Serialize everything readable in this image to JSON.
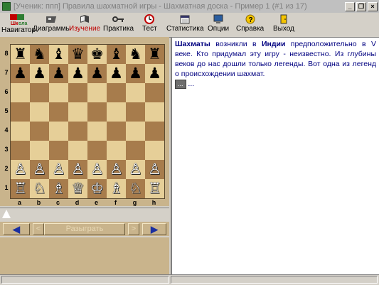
{
  "window": {
    "title": "[Ученик: ппп] Правила шахматной игры - Шахматная доска - Пример 1 (#1 из 17)",
    "controls": [
      "_",
      "❐",
      "×"
    ]
  },
  "toolbar": {
    "navigator": "Навигатор",
    "items": [
      {
        "label": "Диаграммы",
        "icon": "diagrams-icon"
      },
      {
        "label": "Изучение",
        "icon": "book-icon"
      },
      {
        "label": "Практика",
        "icon": "key-icon"
      },
      {
        "label": "Тест",
        "icon": "clock-icon"
      },
      {
        "label": "Статистика",
        "icon": "calendar-icon"
      },
      {
        "label": "Опции",
        "icon": "monitor-icon"
      },
      {
        "label": "Справка",
        "icon": "help-icon"
      },
      {
        "label": "Выход",
        "icon": "door-icon"
      }
    ],
    "active": "Изучение",
    "active_color": "#c00000"
  },
  "board": {
    "ranks": [
      "8",
      "7",
      "6",
      "5",
      "4",
      "3",
      "2",
      "1"
    ],
    "files": [
      "a",
      "b",
      "c",
      "d",
      "e",
      "f",
      "g",
      "h"
    ],
    "position": [
      [
        "♜",
        "♞",
        "♝",
        "♛",
        "♚",
        "♝",
        "♞",
        "♜"
      ],
      [
        "♟",
        "♟",
        "♟",
        "♟",
        "♟",
        "♟",
        "♟",
        "♟"
      ],
      [
        "",
        "",
        "",
        "",
        "",
        "",
        "",
        ""
      ],
      [
        "",
        "",
        "",
        "",
        "",
        "",
        "",
        ""
      ],
      [
        "",
        "",
        "",
        "",
        "",
        "",
        "",
        ""
      ],
      [
        "",
        "",
        "",
        "",
        "",
        "",
        "",
        ""
      ],
      [
        "♙",
        "♙",
        "♙",
        "♙",
        "♙",
        "♙",
        "♙",
        "♙"
      ],
      [
        "♖",
        "♘",
        "♗",
        "♕",
        "♔",
        "♗",
        "♘",
        "♖"
      ]
    ],
    "light_color": "#e6cf98",
    "dark_color": "#a77c4c"
  },
  "controls": {
    "first": "◀",
    "prev": "<",
    "play": "Разыграть",
    "next": ">",
    "last": "▶"
  },
  "text": {
    "parts": [
      {
        "t": "Шахматы",
        "b": true
      },
      {
        "t": " возникли в ",
        "b": false
      },
      {
        "t": "Индии",
        "b": true
      },
      {
        "t": " предположительно в V веке. Кто придумал эту игру - неизвестно. Из глубины веков до нас дошли только легенды. Вот одна из легенд о происхождении шахмат.",
        "b": false
      }
    ],
    "more_button": "...",
    "trailing": " ..."
  }
}
